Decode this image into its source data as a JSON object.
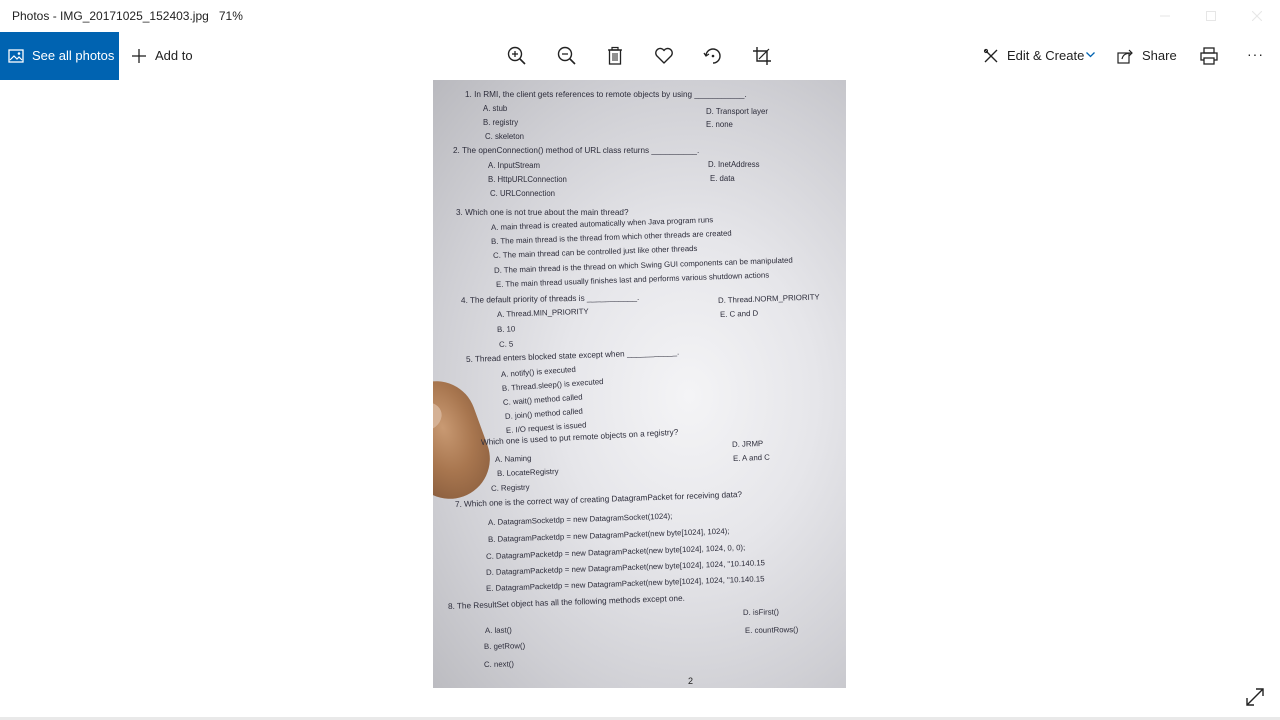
{
  "window": {
    "title": "Photos - IMG_20171025_152403.jpg",
    "zoom": "71%"
  },
  "toolbar": {
    "see_all_label": "See all photos",
    "add_to_label": "Add to",
    "edit_create_label": "Edit & Create",
    "share_label": "Share",
    "more_label": "···"
  },
  "colors": {
    "accent": "#0063b1"
  },
  "icons": [
    "photos-icon",
    "plus-icon",
    "zoom-in-icon",
    "zoom-out-icon",
    "delete-icon",
    "heart-icon",
    "rotate-icon",
    "crop-icon",
    "edit-create-icon",
    "chevron-down-icon",
    "share-icon",
    "print-icon",
    "more-icon",
    "minimize-icon",
    "maximize-icon",
    "close-icon",
    "expand-icon"
  ],
  "photo": {
    "page_number": "2",
    "questions": [
      {
        "text": "1.   In RMI, the client gets references to remote objects by using ___________.",
        "options": [
          "A.   stub",
          "B.   registry",
          "C.   skeleton",
          "D.   Transport layer",
          "E.   none"
        ]
      },
      {
        "text": "2.   The openConnection() method of URL class returns __________.",
        "options": [
          "A.   InputStream",
          "B.   HttpURLConnection",
          "C.   URLConnection",
          "D.   InetAddress",
          "E.   data"
        ]
      },
      {
        "text": "3.   Which one is not true about the main thread?",
        "options": [
          "A.   main thread is created automatically when Java program runs",
          "B.   The main thread is the thread from which other threads are created",
          "C.   The main thread can be controlled just like other threads",
          "D.   The main thread is the thread on which Swing GUI components can be manipulated",
          "E.   The main thread usually finishes last and performs various shutdown actions"
        ]
      },
      {
        "text": "4.   The default priority of threads is ___________.",
        "options": [
          "A.   Thread.MIN_PRIORITY",
          "B.   10",
          "C.   5",
          "D.   Thread.NORM_PRIORITY",
          "E.   C and D"
        ]
      },
      {
        "text": "5.   Thread enters blocked state except when ___________.",
        "options": [
          "A.   notify() is executed",
          "B.   Thread.sleep() is executed",
          "C.   wait() method called",
          "D.   join() method called",
          "E.   I/O request is issued"
        ]
      },
      {
        "text": "Which one is used to put remote objects on a registry?",
        "options": [
          "A.   Naming",
          "B.   LocateRegistry",
          "C.   Registry",
          "D.   JRMP",
          "E.   A and C"
        ]
      },
      {
        "text": "7.   Which one is the correct way of creating DatagramPacket for receiving data?",
        "options": [
          "A.   DatagramSocketdp = new DatagramSocket(1024);",
          "B.   DatagramPacketdp = new DatagramPacket(new byte[1024], 1024);",
          "C.   DatagramPacketdp = new DatagramPacket(new byte[1024], 1024, 0, 0);",
          "D.   DatagramPacketdp = new DatagramPacket(new byte[1024], 1024, \"10.140.15",
          "E.   DatagramPacketdp = new DatagramPacket(new byte[1024], 1024, \"10.140.15"
        ]
      },
      {
        "text": "8.   The ResultSet object has all the following methods except one.",
        "options": [
          "A.   last()",
          "B.   getRow()",
          "C.   next()",
          "D.   isFirst()",
          "E.   countRows()"
        ]
      }
    ]
  }
}
